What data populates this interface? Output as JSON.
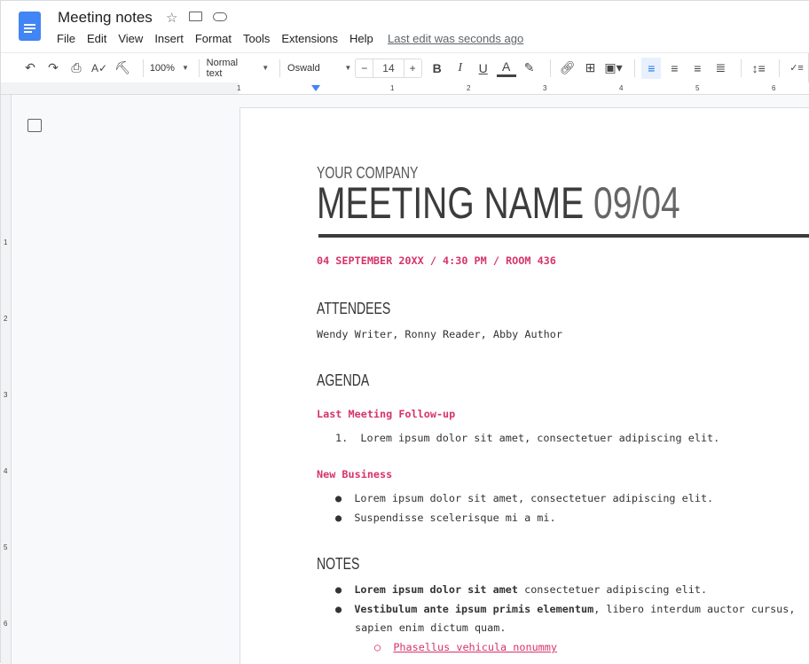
{
  "app": {
    "title": "Meeting notes",
    "menu": [
      "File",
      "Edit",
      "View",
      "Insert",
      "Format",
      "Tools",
      "Extensions",
      "Help"
    ],
    "last_edit": "Last edit was seconds ago"
  },
  "toolbar": {
    "zoom": "100%",
    "style": "Normal text",
    "font": "Oswald",
    "font_size": "14",
    "minus": "−",
    "plus": "+"
  },
  "ruler": {
    "h": [
      "1",
      "1",
      "2",
      "3",
      "4",
      "5",
      "6"
    ],
    "v": [
      "1",
      "2",
      "3",
      "4",
      "5",
      "6"
    ]
  },
  "doc": {
    "company": "YOUR COMPANY",
    "meeting_name": "MEETING NAME",
    "meeting_date": "09/04",
    "details": "04 SEPTEMBER 20XX / 4:30 PM / ROOM 436",
    "attendees_heading": "ATTENDEES",
    "attendees": "Wendy Writer, Ronny Reader, Abby Author",
    "agenda_heading": "AGENDA",
    "followup_heading": "Last Meeting Follow-up",
    "followup_items": [
      "Lorem ipsum dolor sit amet, consectetuer adipiscing elit."
    ],
    "newbiz_heading": "New Business",
    "newbiz_items": [
      "Lorem ipsum dolor sit amet, consectetuer adipiscing elit.",
      "Suspendisse scelerisque mi a mi."
    ],
    "notes_heading": "NOTES",
    "notes": [
      {
        "bold": "Lorem ipsum dolor sit amet",
        "rest": " consectetuer adipiscing elit."
      },
      {
        "bold": "Vestibulum ante ipsum primis elementum",
        "rest": ", libero interdum auctor cursus,",
        "rest2": "sapien enim dictum quam."
      }
    ],
    "sub_link": "Phasellus vehicula nonummy"
  },
  "colors": {
    "accent": "#d6336c",
    "blue": "#4285f4"
  }
}
